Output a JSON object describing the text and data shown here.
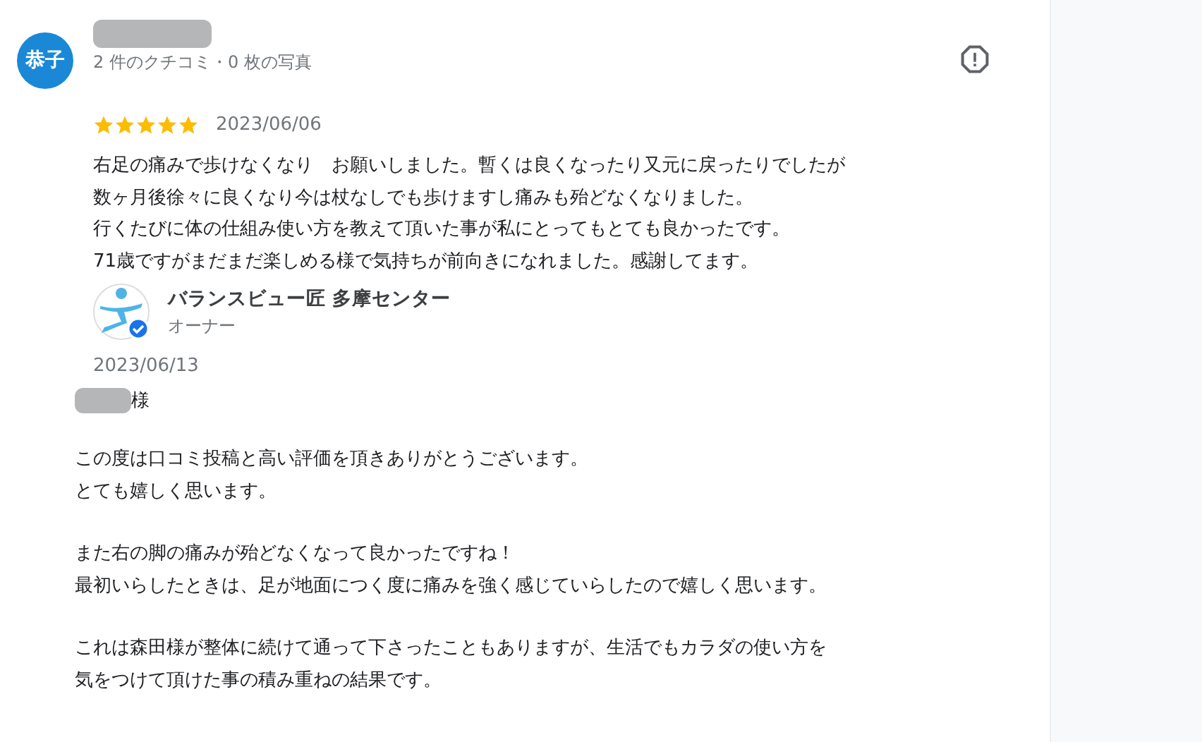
{
  "review": {
    "avatar_text": "恭子",
    "meta": "2 件のクチコミ・0 枚の写真",
    "stars": 5,
    "date": "2023/06/06",
    "lines": [
      "右足の痛みで歩けなくなり　お願いしました。暫くは良くなったり又元に戻ったりでしたが",
      "数ヶ月後徐々に良くなり今は杖なしでも歩けますし痛みも殆どなくなりました。",
      "行くたびに体の仕組み使い方を教えて頂いた事が私にとってもとても良かったです。",
      "71歳ですがまだまだ楽しめる様で気持ちが前向きになれました。感謝してます。"
    ]
  },
  "owner_reply": {
    "name": "バランスビュー匠 多摩センター",
    "role": "オーナー",
    "date": "2023/06/13",
    "salutation": "様",
    "paragraphs": [
      [
        "この度は口コミ投稿と高い評価を頂きありがとうございます。",
        "とても嬉しく思います。"
      ],
      [
        "また右の脚の痛みが殆どなくなって良かったですね！",
        "最初いらしたときは、足が地面につく度に痛みを強く感じていらしたので嬉しく思います。"
      ],
      [
        "これは森田様が整体に続けて通って下さったこともありますが、生活でもカラダの使い方を",
        "気をつけて頂けた事の積み重ねの結果です。"
      ]
    ]
  }
}
